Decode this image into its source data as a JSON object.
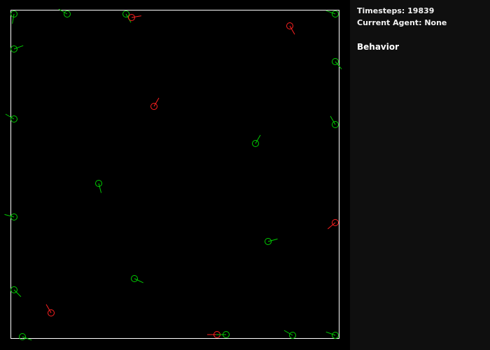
{
  "panel": {
    "timesteps_label": "Timesteps:",
    "timesteps_value": "19839",
    "current_agent_label": "Current Agent:",
    "current_agent_value": "None",
    "behavior_heading": "Behavior"
  },
  "colors": {
    "background": "#000000",
    "panel_background": "#0f0f0f",
    "arena_border": "#ffffff",
    "agent_green": "#00cc00",
    "agent_red": "#ff2020"
  },
  "agents": [
    {
      "color": "green",
      "heading_deg": 100
    },
    {
      "color": "green",
      "heading_deg": 210
    },
    {
      "color": "green",
      "heading_deg": 60
    },
    {
      "color": "red",
      "heading_deg": 350
    },
    {
      "color": "green",
      "heading_deg": 200
    },
    {
      "color": "red",
      "heading_deg": 60
    },
    {
      "color": "green",
      "heading_deg": 340
    },
    {
      "color": "green",
      "heading_deg": 50
    },
    {
      "color": "red",
      "heading_deg": 300
    },
    {
      "color": "green",
      "heading_deg": 210
    },
    {
      "color": "green",
      "heading_deg": 300
    },
    {
      "color": "green",
      "heading_deg": 240
    },
    {
      "color": "green",
      "heading_deg": 75
    },
    {
      "color": "green",
      "heading_deg": 195
    },
    {
      "color": "red",
      "heading_deg": 140
    },
    {
      "color": "green",
      "heading_deg": 345
    },
    {
      "color": "green",
      "heading_deg": 25
    },
    {
      "color": "green",
      "heading_deg": 45
    },
    {
      "color": "red",
      "heading_deg": 240
    },
    {
      "color": "green",
      "heading_deg": 20
    },
    {
      "color": "red",
      "heading_deg": 180
    },
    {
      "color": "green",
      "heading_deg": 180
    },
    {
      "color": "green",
      "heading_deg": 210
    },
    {
      "color": "green",
      "heading_deg": 200
    }
  ]
}
